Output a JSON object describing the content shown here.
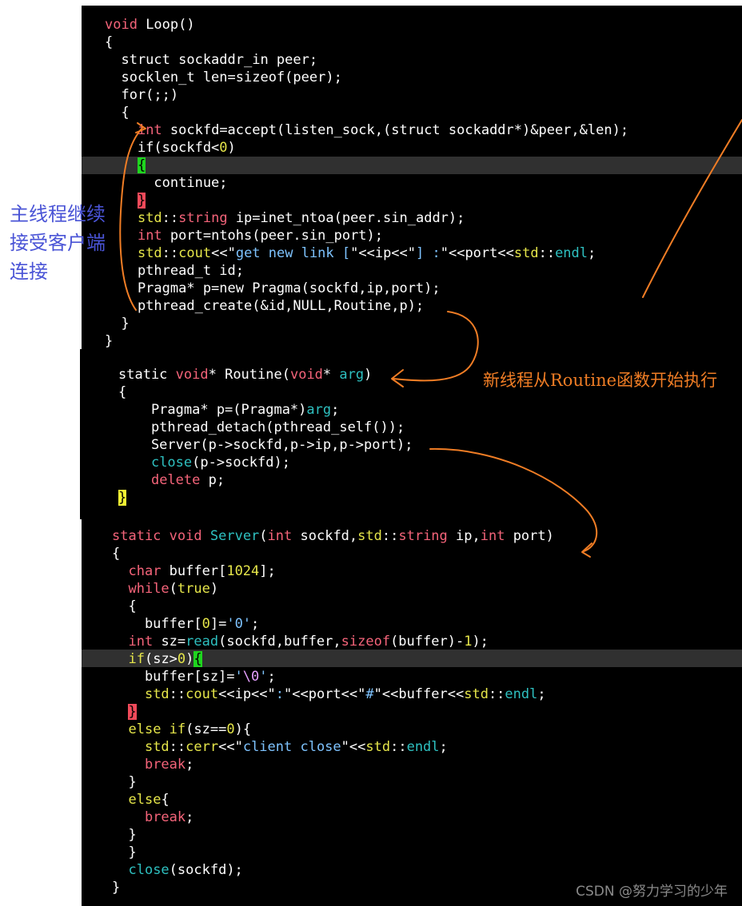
{
  "code_blocks": {
    "loop": [
      [
        [
          "kw",
          "void"
        ],
        [
          "pln",
          " Loop()"
        ]
      ],
      [
        [
          "pln",
          "{"
        ]
      ],
      [
        [
          "pln",
          "  struct sockaddr_in peer;"
        ]
      ],
      [
        [
          "pln",
          "  socklen_t len=sizeof(peer);"
        ]
      ],
      [
        [
          "pln",
          "  for(;;)"
        ]
      ],
      [
        [
          "pln",
          "  {"
        ]
      ],
      [
        [
          "pln",
          "    "
        ],
        [
          "ty",
          "int"
        ],
        [
          "pln",
          " sockfd=accept(listen_sock,(struct sockaddr*)&peer,&len);"
        ]
      ],
      [
        [
          "pln",
          "    if(sockfd<"
        ],
        [
          "num",
          "0"
        ],
        [
          "pln",
          ")"
        ]
      ],
      [
        [
          "pln",
          "    "
        ],
        [
          "bk-green",
          "{"
        ]
      ],
      [
        [
          "pln",
          "      continue;"
        ]
      ],
      [
        [
          "pln",
          "    "
        ],
        [
          "bk-red",
          "}"
        ]
      ],
      [
        [
          "pln",
          "    "
        ],
        [
          "ns",
          "std"
        ],
        [
          "pln",
          "::"
        ],
        [
          "ty",
          "string"
        ],
        [
          "pln",
          " ip=inet_ntoa(peer.sin_addr);"
        ]
      ],
      [
        [
          "pln",
          "    "
        ],
        [
          "ty",
          "int"
        ],
        [
          "pln",
          " port=ntohs(peer.sin_port);"
        ]
      ],
      [
        [
          "pln",
          "    "
        ],
        [
          "ns",
          "std"
        ],
        [
          "pln",
          "::"
        ],
        [
          "ns",
          "cout"
        ],
        [
          "pln",
          "<<\""
        ],
        [
          "str",
          "get new link ["
        ],
        [
          "pln",
          "\"<<ip<<\""
        ],
        [
          "str",
          "] :"
        ],
        [
          "pln",
          "\"<<port<<"
        ],
        [
          "ns",
          "std"
        ],
        [
          "pln",
          "::"
        ],
        [
          "fn",
          "endl"
        ],
        [
          "pln",
          ";"
        ]
      ],
      [
        [
          "pln",
          "    pthread_t id;"
        ]
      ],
      [
        [
          "pln",
          "    Pragma* p=new Pragma(sockfd,ip,port);"
        ]
      ],
      [
        [
          "pln",
          "    pthread_create(&id,NULL,Routine,p);"
        ]
      ],
      [
        [
          "pln",
          "  }"
        ]
      ],
      [
        [
          "pln",
          "}"
        ]
      ]
    ],
    "routine": [
      [
        [
          "pln",
          "static "
        ],
        [
          "kw",
          "void"
        ],
        [
          "pln",
          "* Routine("
        ],
        [
          "kw",
          "void"
        ],
        [
          "pln",
          "* "
        ],
        [
          "fn",
          "arg"
        ],
        [
          "pln",
          ")"
        ]
      ],
      [
        [
          "pln",
          "{"
        ]
      ],
      [
        [
          "pln",
          "    Pragma* p=(Pragma*)"
        ],
        [
          "fn",
          "arg"
        ],
        [
          "pln",
          ";"
        ]
      ],
      [
        [
          "pln",
          "    pthread_detach(pthread_self());"
        ]
      ],
      [
        [
          "pln",
          "    Server(p->sockfd,p->ip,p->port);"
        ]
      ],
      [
        [
          "pln",
          "    "
        ],
        [
          "fn",
          "close"
        ],
        [
          "pln",
          "(p->sockfd);"
        ]
      ],
      [
        [
          "pln",
          "    "
        ],
        [
          "kw",
          "delete"
        ],
        [
          "pln",
          " p;"
        ]
      ],
      [
        [
          "bk-yellow",
          "}"
        ]
      ]
    ],
    "server": [
      [
        [
          "kw",
          "static"
        ],
        [
          "pln",
          " "
        ],
        [
          "kw",
          "void"
        ],
        [
          "pln",
          " "
        ],
        [
          "fn",
          "Server"
        ],
        [
          "pln",
          "("
        ],
        [
          "ty",
          "int"
        ],
        [
          "pln",
          " sockfd,"
        ],
        [
          "ns",
          "std"
        ],
        [
          "pln",
          "::"
        ],
        [
          "ty",
          "string"
        ],
        [
          "pln",
          " ip,"
        ],
        [
          "ty",
          "int"
        ],
        [
          "pln",
          " port)"
        ]
      ],
      [
        [
          "pln",
          "{"
        ]
      ],
      [
        [
          "pln",
          "  "
        ],
        [
          "ty",
          "char"
        ],
        [
          "pln",
          " buffer["
        ],
        [
          "num",
          "1024"
        ],
        [
          "pln",
          "];"
        ]
      ],
      [
        [
          "pln",
          "  "
        ],
        [
          "kw",
          "while"
        ],
        [
          "pln",
          "("
        ],
        [
          "ns",
          "true"
        ],
        [
          "pln",
          ")"
        ]
      ],
      [
        [
          "pln",
          "  {"
        ]
      ],
      [
        [
          "pln",
          "    buffer["
        ],
        [
          "num",
          "0"
        ],
        [
          "pln",
          "]="
        ],
        [
          "str",
          "'0'"
        ],
        [
          "pln",
          ";"
        ]
      ],
      [
        [
          "pln",
          "  "
        ],
        [
          "ty",
          "int"
        ],
        [
          "pln",
          " sz="
        ],
        [
          "fn",
          "read"
        ],
        [
          "pln",
          "(sockfd,buffer,"
        ],
        [
          "kw",
          "sizeof"
        ],
        [
          "pln",
          "(buffer)-"
        ],
        [
          "num",
          "1"
        ],
        [
          "pln",
          ");"
        ]
      ],
      [
        [
          "pln",
          "  "
        ],
        [
          "ns",
          "if"
        ],
        [
          "pln",
          "(sz>"
        ],
        [
          "num",
          "0"
        ],
        [
          "pln",
          ")"
        ],
        [
          "bk-green",
          "{"
        ]
      ],
      [
        [
          "pln",
          "    buffer[sz]="
        ],
        [
          "str",
          "'"
        ],
        [
          "ch",
          "\\0"
        ],
        [
          "str",
          "'"
        ],
        [
          "pln",
          ";"
        ]
      ],
      [
        [
          "pln",
          "    "
        ],
        [
          "ns",
          "std"
        ],
        [
          "pln",
          "::"
        ],
        [
          "ns",
          "cout"
        ],
        [
          "pln",
          "<<ip<<\""
        ],
        [
          "str",
          ":"
        ],
        [
          "pln",
          "\"<<port<<\""
        ],
        [
          "str",
          "#"
        ],
        [
          "pln",
          "\"<<buffer<<"
        ],
        [
          "ns",
          "std"
        ],
        [
          "pln",
          "::"
        ],
        [
          "fn",
          "endl"
        ],
        [
          "pln",
          ";"
        ]
      ],
      [
        [
          "pln",
          "  "
        ],
        [
          "bk-red",
          "}"
        ]
      ],
      [
        [
          "pln",
          "  "
        ],
        [
          "ns",
          "else if"
        ],
        [
          "pln",
          "(sz=="
        ],
        [
          "num",
          "0"
        ],
        [
          "pln",
          "){"
        ]
      ],
      [
        [
          "pln",
          "    "
        ],
        [
          "ns",
          "std"
        ],
        [
          "pln",
          "::"
        ],
        [
          "ns",
          "cerr"
        ],
        [
          "pln",
          "<<\""
        ],
        [
          "str",
          "client close"
        ],
        [
          "pln",
          "\"<<"
        ],
        [
          "ns",
          "std"
        ],
        [
          "pln",
          "::"
        ],
        [
          "fn",
          "endl"
        ],
        [
          "pln",
          ";"
        ]
      ],
      [
        [
          "pln",
          "    "
        ],
        [
          "kw",
          "break"
        ],
        [
          "pln",
          ";"
        ]
      ],
      [
        [
          "pln",
          "  }"
        ]
      ],
      [
        [
          "pln",
          "  "
        ],
        [
          "ns",
          "else"
        ],
        [
          "pln",
          "{"
        ]
      ],
      [
        [
          "pln",
          "    "
        ],
        [
          "kw",
          "break"
        ],
        [
          "pln",
          ";"
        ]
      ],
      [
        [
          "pln",
          "  }"
        ]
      ],
      [
        [
          "pln",
          "  }"
        ]
      ],
      [
        [
          "pln",
          "  "
        ],
        [
          "fn",
          "close"
        ],
        [
          "pln",
          "(sockfd);"
        ]
      ],
      [
        [
          "pln",
          "}"
        ]
      ]
    ]
  },
  "annotations": {
    "main_thread": [
      "主线程继续",
      "接受客户端",
      "连接"
    ],
    "new_thread": "新线程从Routine函数开始执行"
  },
  "watermark": "CSDN @努力学习的少年",
  "colors": {
    "background": "#000000",
    "arrow": "#f07d25",
    "note_blue": "#4a54d6",
    "keyword": "#f5647a",
    "namespace": "#e6e64a",
    "function": "#2ec0c0",
    "string": "#7ec3ff"
  }
}
